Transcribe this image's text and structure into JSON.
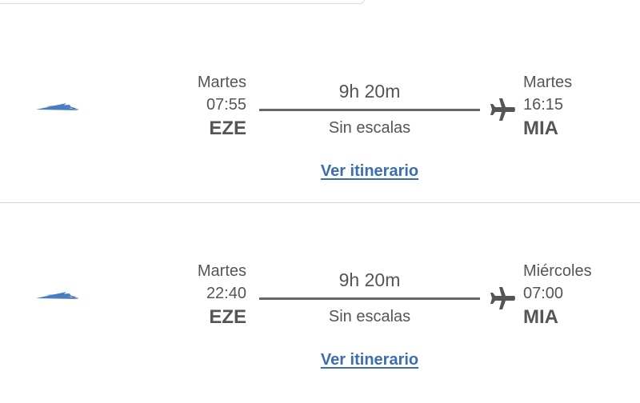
{
  "colors": {
    "text": "#555555",
    "link": "#3b6eb0",
    "logo": "#4a7cc2",
    "divider": "#d6d6d6"
  },
  "flights": [
    {
      "airline_icon": "airline-logo-icon",
      "departure": {
        "day": "Martes",
        "time": "07:55",
        "airport": "EZE"
      },
      "duration": "9h 20m",
      "stops": "Sin escalas",
      "arrival": {
        "day": "Martes",
        "time": "16:15",
        "airport": "MIA"
      },
      "itinerary_link": "Ver itinerario"
    },
    {
      "airline_icon": "airline-logo-icon",
      "departure": {
        "day": "Martes",
        "time": "22:40",
        "airport": "EZE"
      },
      "duration": "9h 20m",
      "stops": "Sin escalas",
      "arrival": {
        "day": "Miércoles",
        "time": "07:00",
        "airport": "MIA"
      },
      "itinerary_link": "Ver itinerario"
    }
  ]
}
